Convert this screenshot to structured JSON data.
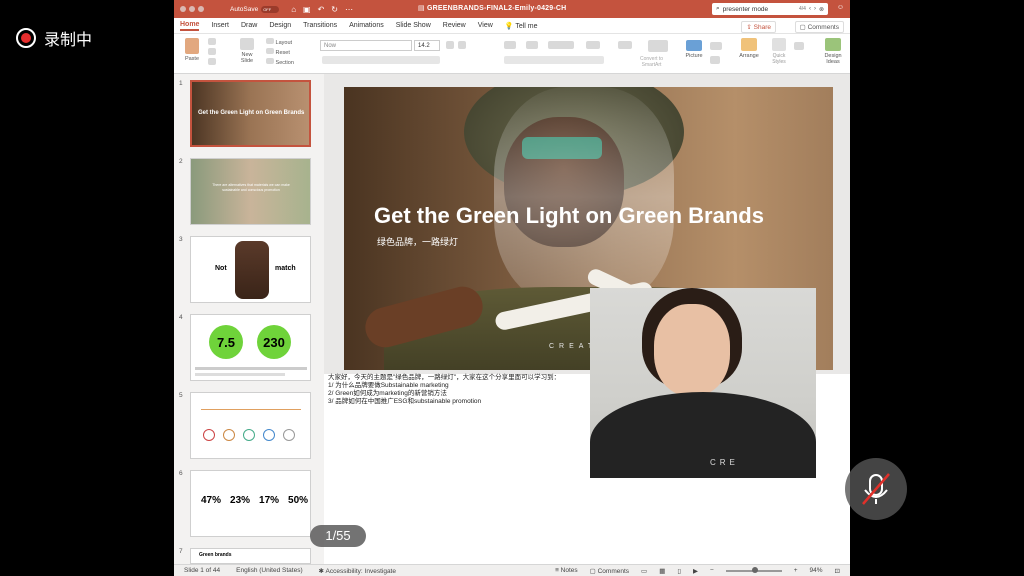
{
  "recording": {
    "label": "录制中"
  },
  "window": {
    "autosave_label": "AutoSave",
    "autosave_state": "OFF",
    "doc_title": "GREENBRANDS-FINAL2-Emily-0429-CH",
    "search_value": "presenter mode",
    "search_count": "4/4",
    "accent_color": "#c4533e"
  },
  "menu": {
    "tabs": [
      "Home",
      "Insert",
      "Draw",
      "Design",
      "Transitions",
      "Animations",
      "Slide Show",
      "Review",
      "View",
      "Tell me"
    ],
    "share": "Share",
    "comments": "Comments"
  },
  "ribbon": {
    "paste": "Paste",
    "new_slide": "New\nSlide",
    "layout": "Layout",
    "reset": "Reset",
    "section": "Section",
    "font_value": "Now",
    "font_size": "14.2",
    "convert_smartart": "Convert to\nSmartArt",
    "picture": "Picture",
    "arrange": "Arrange",
    "quick_styles": "Quick\nStyles",
    "design_ideas": "Design\nIdeas"
  },
  "thumbnails": [
    {
      "num": "1",
      "title": "Get the Green Light on Green Brands"
    },
    {
      "num": "2",
      "text": "There are alternatives that materials we can make sustainable and conscious promotion"
    },
    {
      "num": "3",
      "left": "Not",
      "right": "match"
    },
    {
      "num": "4",
      "a": "7.5",
      "b": "230"
    },
    {
      "num": "5"
    },
    {
      "num": "6",
      "stats": [
        "47%",
        "23%",
        "17%",
        "50%"
      ]
    },
    {
      "num": "7",
      "title": "Green brands"
    }
  ],
  "slide": {
    "title": "Get the Green Light on Green Brands",
    "subtitle": "绿色品牌，一路绿灯",
    "brand": "CREATEC"
  },
  "notes": {
    "lines": [
      "大家好，今天的主题是\"绿色品牌，一路绿灯\"，大家在这个分享里面可以学习到：",
      "1/ 为什么品牌要做Substainable marketing",
      "2/ Green如何成为marketing的新营销方法",
      "3/ 品牌如何在中国推广ESG和substainable promotion"
    ]
  },
  "pager": {
    "label": "1/55"
  },
  "statusbar": {
    "slide": "Slide 1 of 44",
    "language": "English (United States)",
    "accessibility": "Accessibility: Investigate",
    "notes": "Notes",
    "comments": "Comments",
    "zoom": "94%"
  },
  "webcam": {
    "shirt_text": "CRE"
  }
}
